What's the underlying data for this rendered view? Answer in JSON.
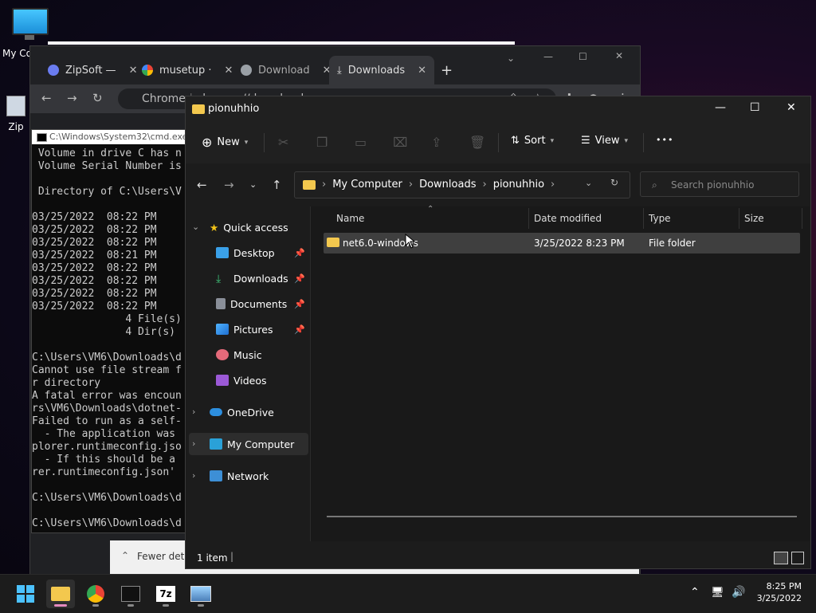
{
  "desktop": {
    "icons": [
      {
        "label": "My Co"
      },
      {
        "label": "Zip"
      }
    ]
  },
  "chrome": {
    "tabs": [
      {
        "label": "ZipSoft —",
        "icon": "zipsoft-icon"
      },
      {
        "label": "musetup ·",
        "icon": "google-icon"
      },
      {
        "label": "Download",
        "icon": "chrome-icon"
      },
      {
        "label": "Downloads",
        "icon": "download-icon"
      }
    ],
    "new_tab": "+",
    "omnibox_prefix": "Chrome",
    "omnibox_url": "chrome://downloads",
    "fewer_details": "Fewer detai"
  },
  "cmd": {
    "title": "C:\\Windows\\System32\\cmd.exe",
    "lines": [
      " Volume in drive C has n",
      " Volume Serial Number is",
      "",
      " Directory of C:\\Users\\V",
      "",
      "03/25/2022  08:22 PM",
      "03/25/2022  08:22 PM",
      "03/25/2022  08:22 PM",
      "03/25/2022  08:21 PM",
      "03/25/2022  08:22 PM",
      "03/25/2022  08:22 PM",
      "03/25/2022  08:22 PM",
      "03/25/2022  08:22 PM",
      "               4 File(s)",
      "               4 Dir(s)",
      "",
      "C:\\Users\\VM6\\Downloads\\d",
      "Cannot use file stream f",
      "r directory",
      "A fatal error was encoun",
      "rs\\VM6\\Downloads\\dotnet-",
      "Failed to run as a self-",
      "  - The application was",
      "plorer.runtimeconfig.jso",
      "  - If this should be a",
      "rer.runtimeconfig.json'",
      "",
      "C:\\Users\\VM6\\Downloads\\d",
      "",
      "C:\\Users\\VM6\\Downloads\\d"
    ]
  },
  "explorer": {
    "title": "pionuhhio",
    "commands": {
      "new": "New",
      "sort": "Sort",
      "view": "View",
      "more": "•••"
    },
    "breadcrumb": [
      "My Computer",
      "Downloads",
      "pionuhhio"
    ],
    "search_placeholder": "Search pionuhhio",
    "sidebar": {
      "quick_access": "Quick access",
      "items": [
        {
          "label": "Desktop",
          "pinned": true
        },
        {
          "label": "Downloads",
          "pinned": true
        },
        {
          "label": "Documents",
          "pinned": true
        },
        {
          "label": "Pictures",
          "pinned": true
        },
        {
          "label": "Music",
          "pinned": false
        },
        {
          "label": "Videos",
          "pinned": false
        }
      ],
      "onedrive": "OneDrive",
      "my_computer": "My Computer",
      "network": "Network"
    },
    "columns": [
      "Name",
      "Date modified",
      "Type",
      "Size"
    ],
    "rows": [
      {
        "name": "net6.0-windows",
        "date": "3/25/2022 8:23 PM",
        "type": "File folder",
        "size": ""
      }
    ],
    "status": "1 item"
  },
  "taskbar": {
    "apps": [
      "start-icon",
      "file-explorer-icon",
      "chrome-icon",
      "terminal-icon",
      "7zip-icon",
      "image-viewer-icon"
    ],
    "seven_zip_label": "7z",
    "time": "8:25 PM",
    "date": "3/25/2022"
  }
}
